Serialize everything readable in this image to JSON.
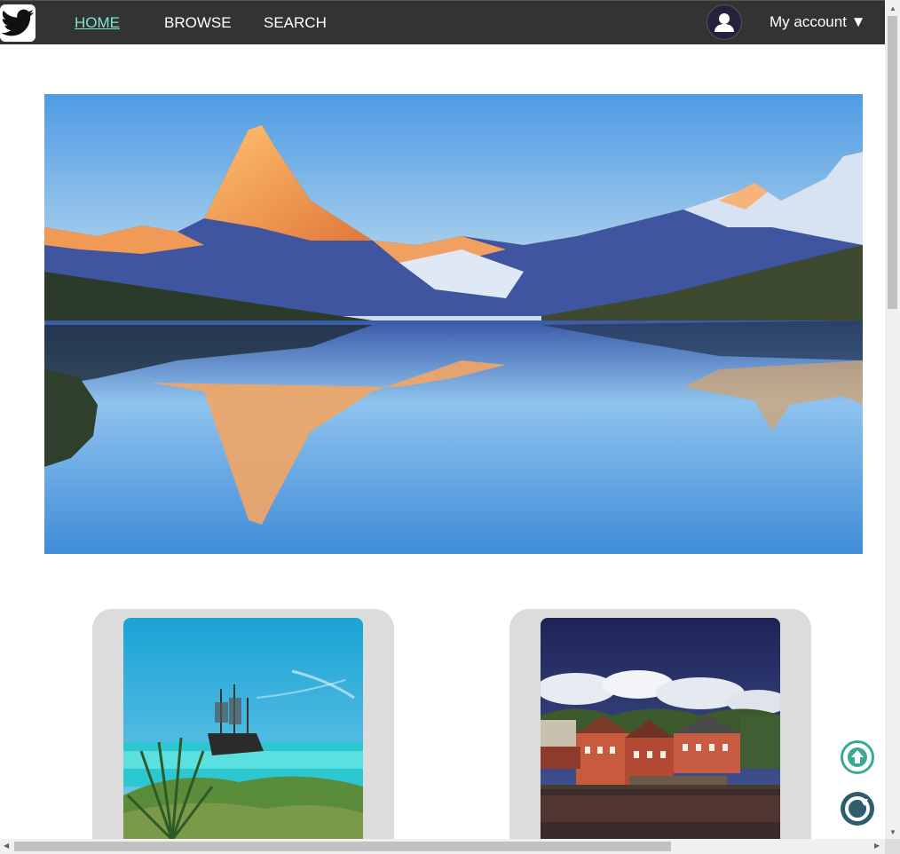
{
  "nav": {
    "links": [
      {
        "label": "HOME",
        "active": true
      },
      {
        "label": "BROWSE",
        "active": false
      },
      {
        "label": "SEARCH",
        "active": false
      }
    ],
    "account_label": "My account ▼"
  },
  "icons": {
    "logo": "twitter-bird-icon",
    "avatar": "user-avatar-icon",
    "scroll_top": "arrow-up-circle-icon",
    "refresh": "refresh-icon"
  },
  "colors": {
    "navbar": "#333333",
    "active_link": "#7ee6cf",
    "card_bg": "#dcdcdc",
    "fab_teal": "#3aa993",
    "fab_dark": "#2f5d6e"
  }
}
